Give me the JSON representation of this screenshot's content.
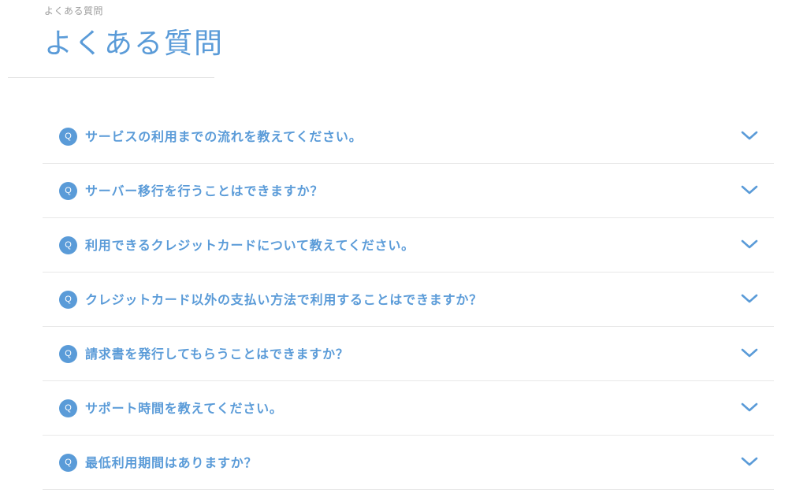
{
  "header": {
    "breadcrumb": "よくある質問",
    "title": "よくある質問"
  },
  "faq": {
    "badge_label": "Q",
    "items": [
      {
        "question": "サービスの利用までの流れを教えてください。"
      },
      {
        "question": "サーバー移行を行うことはできますか？"
      },
      {
        "question": "利用できるクレジットカードについて教えてください。"
      },
      {
        "question": "クレジットカード以外の支払い方法で利用することはできますか？"
      },
      {
        "question": "請求書を発行してもらうことはできますか？"
      },
      {
        "question": "サポート時間を教えてください。"
      },
      {
        "question": "最低利用期間はありますか？"
      }
    ],
    "chevron_icon": "chevron-down-icon"
  },
  "colors": {
    "accent": "#5a9bd8",
    "muted_text": "#9e9e9e",
    "divider": "#e8e8e8",
    "background": "#ffffff"
  }
}
